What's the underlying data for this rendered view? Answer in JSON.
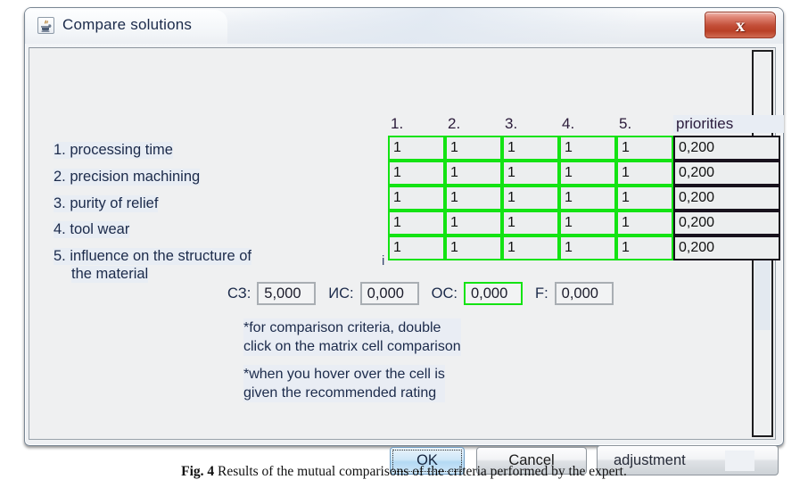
{
  "window": {
    "title": "Compare solutions",
    "app_icon": "java-coffee-cup-icon",
    "close_label": "x"
  },
  "matrix": {
    "column_headers": [
      "1.",
      "2.",
      "3.",
      "4.",
      "5."
    ],
    "priorities_header": "priorities",
    "criteria": [
      {
        "num": "1.",
        "label": "processing time"
      },
      {
        "num": "2.",
        "label": "precision machining"
      },
      {
        "num": "3.",
        "label": "purity of relief"
      },
      {
        "num": "4.",
        "label": "tool wear"
      },
      {
        "num": "5.",
        "label": "influence on the structure of",
        "label2": "the material"
      }
    ],
    "truncated_marker": "i",
    "rows": [
      {
        "cells": [
          "1",
          "1",
          "1",
          "1",
          "1"
        ],
        "priority": "0,200"
      },
      {
        "cells": [
          "1",
          "1",
          "1",
          "1",
          "1"
        ],
        "priority": "0,200"
      },
      {
        "cells": [
          "1",
          "1",
          "1",
          "1",
          "1"
        ],
        "priority": "0,200"
      },
      {
        "cells": [
          "1",
          "1",
          "1",
          "1",
          "1"
        ],
        "priority": "0,200"
      },
      {
        "cells": [
          "1",
          "1",
          "1",
          "1",
          "1"
        ],
        "priority": "0,200"
      }
    ],
    "cell_border_color": "#13e313",
    "priority_border_color": "#18121d"
  },
  "fields": [
    {
      "label": "СЗ:",
      "value": "5,000",
      "highlighted": false
    },
    {
      "label": "ИС:",
      "value": "0,000",
      "highlighted": false
    },
    {
      "label": "ОС:",
      "value": "0,000",
      "highlighted": true
    },
    {
      "label": "F:",
      "value": "0,000",
      "highlighted": false
    }
  ],
  "hints": [
    "*for comparison criteria, double\nclick on the matrix cell comparison",
    "*when you hover over the cell is\ngiven the recommended rating"
  ],
  "buttons": {
    "ok": "OK",
    "cancel": "Cancel",
    "adjustment": "adjustment"
  },
  "caption": {
    "figure": "Fig. 4",
    "text": "Results of the mutual comparisons of the criteria performed by the expert."
  }
}
